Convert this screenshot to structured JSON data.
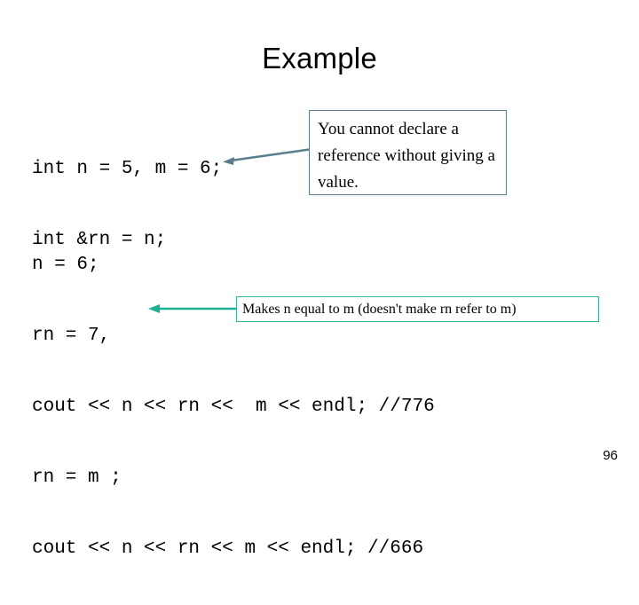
{
  "slide": {
    "title": "Example",
    "page_number": "96"
  },
  "code_block_1": {
    "lines": [
      "int n = 5, m = 6;",
      "int &rn = n;"
    ]
  },
  "code_block_2": {
    "lines": [
      "n = 6;",
      "rn = 7,",
      "cout << n << rn <<  m << endl; //776",
      "rn = m ;",
      "cout << n << rn << m << endl; //666"
    ]
  },
  "callouts": {
    "reference": {
      "text": "You cannot declare a reference without giving a value.",
      "border_color": "#5b7d8c",
      "arrow_color": "#5b7d8c"
    },
    "assign": {
      "text": "Makes n equal to m (doesn't make rn refer to m)",
      "border_color": "#3cb39a",
      "arrow_color": "#1ab394"
    }
  },
  "colors": {
    "background": "#ffffff",
    "text": "#000000",
    "callout_blue": "#5b7d8c",
    "callout_teal": "#3cb39a"
  }
}
